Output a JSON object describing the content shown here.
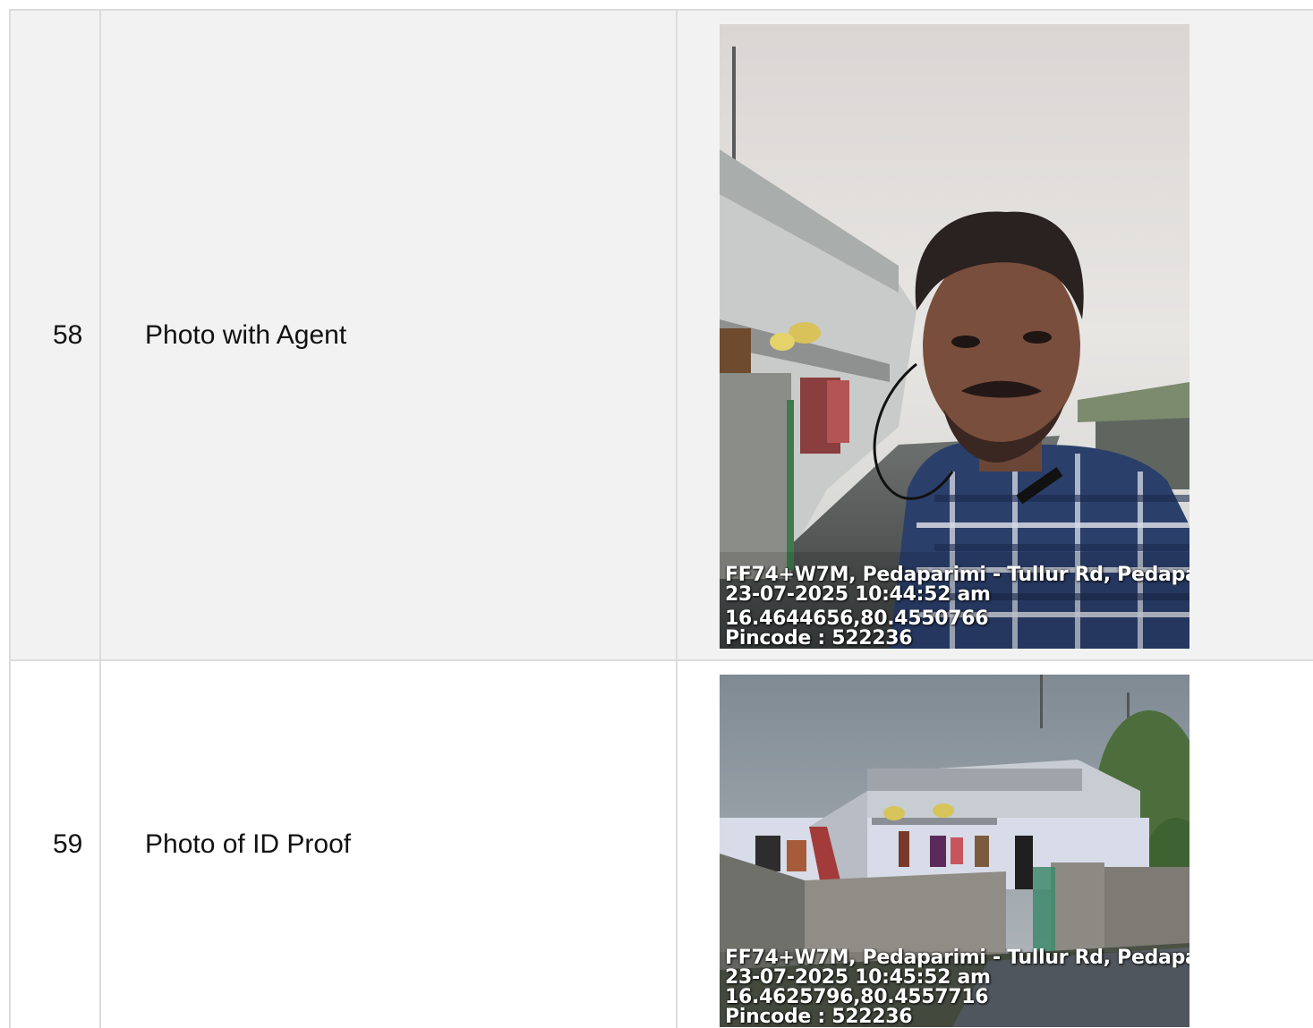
{
  "rows": [
    {
      "number": "58",
      "label": "Photo with Agent",
      "photo": {
        "description": "selfie",
        "overlay": {
          "address": "FF74+W7M, Pedaparimi - Tullur Rd, Pedapar",
          "timestamp": "23-07-2025 10:44:52 am",
          "coordinates": "16.4644656,80.4550766",
          "pincode": "Pincode : 522236"
        }
      }
    },
    {
      "number": "59",
      "label": "Photo of ID Proof",
      "photo": {
        "description": "house",
        "overlay": {
          "address": "FF74+W7M, Pedaparimi - Tullur Rd, Pedapar",
          "timestamp": "23-07-2025 10:45:52 am",
          "coordinates": "16.4625796,80.4557716",
          "pincode": "Pincode : 522236"
        }
      }
    }
  ]
}
